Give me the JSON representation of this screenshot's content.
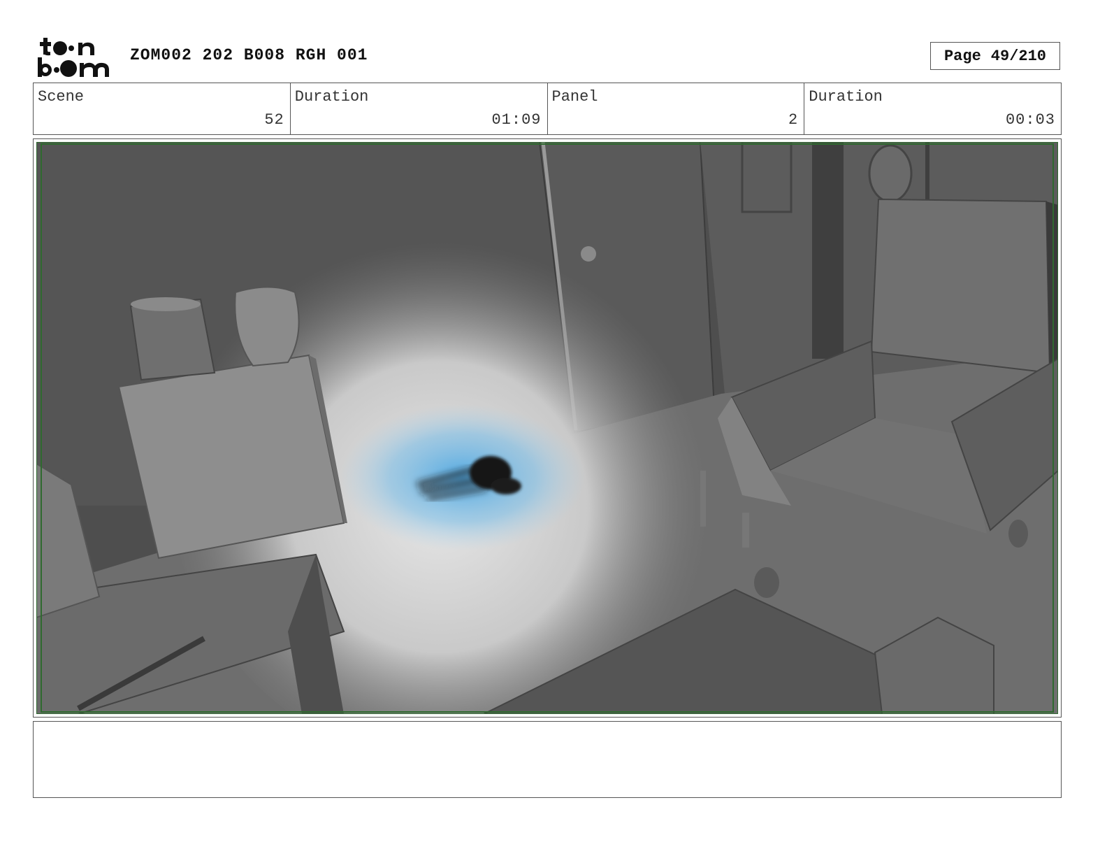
{
  "header": {
    "logo_text": "toon boom",
    "title": "ZOM002 202 B008 RGH 001",
    "page_label": "Page",
    "page_number": "49/210"
  },
  "info": {
    "scene_label": "Scene",
    "scene_value": "52",
    "scene_duration_label": "Duration",
    "scene_duration_value": "01:09",
    "panel_label": "Panel",
    "panel_value": "2",
    "panel_duration_label": "Duration",
    "panel_duration_value": "00:03"
  },
  "colors": {
    "frame_border": "#555555",
    "safe_area": "#2f6a2f",
    "glow": "#5aaee0"
  }
}
